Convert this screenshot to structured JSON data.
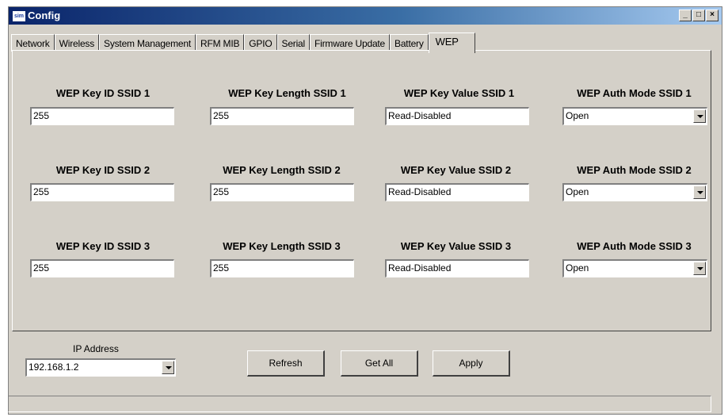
{
  "window": {
    "title": "Config",
    "app_icon_text": "sim"
  },
  "title_buttons": {
    "minimize": "_",
    "maximize": "□",
    "close": "×"
  },
  "tabs": [
    {
      "label": "Network"
    },
    {
      "label": "Wireless"
    },
    {
      "label": "System Management"
    },
    {
      "label": "RFM MIB"
    },
    {
      "label": "GPIO"
    },
    {
      "label": "Serial"
    },
    {
      "label": "Firmware Update"
    },
    {
      "label": "Battery"
    },
    {
      "label": "WEP",
      "active": true
    }
  ],
  "rows": [
    {
      "key_id_label": "WEP Key ID SSID 1",
      "key_id": "255",
      "key_length_label": "WEP Key Length SSID 1",
      "key_length": "255",
      "key_value_label": "WEP Key Value SSID 1",
      "key_value": "Read-Disabled",
      "auth_mode_label": "WEP Auth Mode SSID 1",
      "auth_mode": "Open"
    },
    {
      "key_id_label": "WEP Key ID SSID 2",
      "key_id": "255",
      "key_length_label": "WEP Key Length SSID 2",
      "key_length": "255",
      "key_value_label": "WEP Key Value SSID 2",
      "key_value": "Read-Disabled",
      "auth_mode_label": "WEP Auth Mode SSID 2",
      "auth_mode": "Open"
    },
    {
      "key_id_label": "WEP Key ID SSID 3",
      "key_id": "255",
      "key_length_label": "WEP Key Length SSID 3",
      "key_length": "255",
      "key_value_label": "WEP Key Value SSID 3",
      "key_value": "Read-Disabled",
      "auth_mode_label": "WEP Auth Mode SSID 3",
      "auth_mode": "Open"
    }
  ],
  "bottom": {
    "ip_label": "IP Address",
    "ip_value": "192.168.1.2",
    "refresh_label": "Refresh",
    "get_all_label": "Get All",
    "apply_label": "Apply"
  },
  "colors": {
    "face": "#d4d0c8",
    "titlebar_start": "#0a246a",
    "titlebar_end": "#a6caf0"
  },
  "icons": {
    "app": "config-app-icon",
    "dropdown": "chevron-down-icon"
  }
}
